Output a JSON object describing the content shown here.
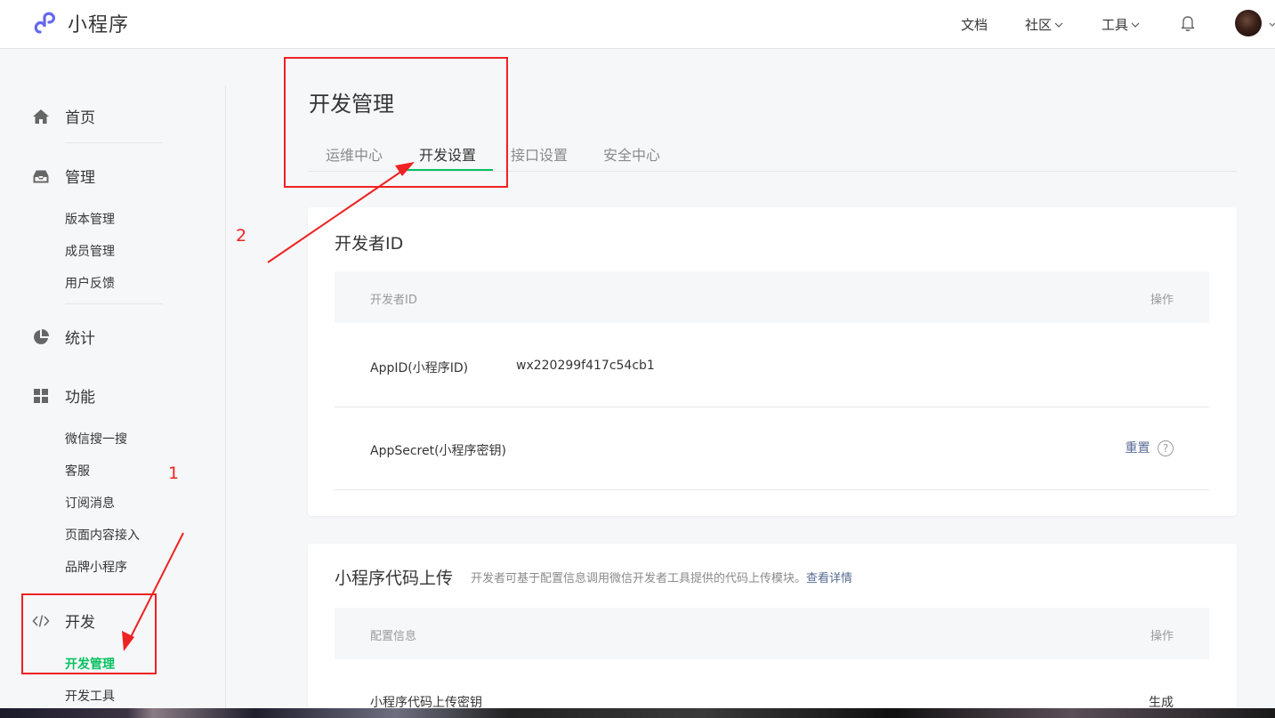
{
  "header": {
    "app_title": "小程序",
    "nav": [
      {
        "label": "文档"
      },
      {
        "label": "社区"
      },
      {
        "label": "工具"
      }
    ]
  },
  "sidebar": {
    "groups": [
      {
        "label": "首页",
        "icon": "home-icon"
      },
      {
        "label": "管理",
        "icon": "inbox-icon",
        "items": [
          "版本管理",
          "成员管理",
          "用户反馈"
        ]
      },
      {
        "label": "统计",
        "icon": "pie-chart-icon"
      },
      {
        "label": "功能",
        "icon": "grid-icon",
        "items": [
          "微信搜一搜",
          "客服",
          "订阅消息",
          "页面内容接入",
          "品牌小程序"
        ]
      },
      {
        "label": "开发",
        "icon": "code-icon",
        "items": [
          "开发管理",
          "开发工具"
        ]
      }
    ],
    "active_item": "开发管理"
  },
  "main": {
    "title": "开发管理",
    "tabs": [
      {
        "label": "运维中心"
      },
      {
        "label": "开发设置"
      },
      {
        "label": "接口设置"
      },
      {
        "label": "安全中心"
      }
    ],
    "active_tab": "开发设置",
    "developer_id_card": {
      "title": "开发者ID",
      "col_left": "开发者ID",
      "col_right": "操作",
      "appid_label": "AppID(小程序ID)",
      "appid_value": "wx220299f417c54cb1",
      "secret_label": "AppSecret(小程序密钥)",
      "secret_action": "重置",
      "help_glyph": "?"
    },
    "upload_card": {
      "title": "小程序代码上传",
      "desc": "开发者可基于配置信息调用微信开发者工具提供的代码上传模块。",
      "desc_link": "查看详情",
      "col_left": "配置信息",
      "col_right": "操作",
      "row_label": "小程序代码上传密钥",
      "row_action": "生成"
    }
  },
  "annotations": {
    "label_1": "1",
    "label_2": "2",
    "color": "#ee2222"
  },
  "colors": {
    "accent_green": "#07c160",
    "link_blue": "#576b95",
    "background": "#f6f7f9"
  }
}
